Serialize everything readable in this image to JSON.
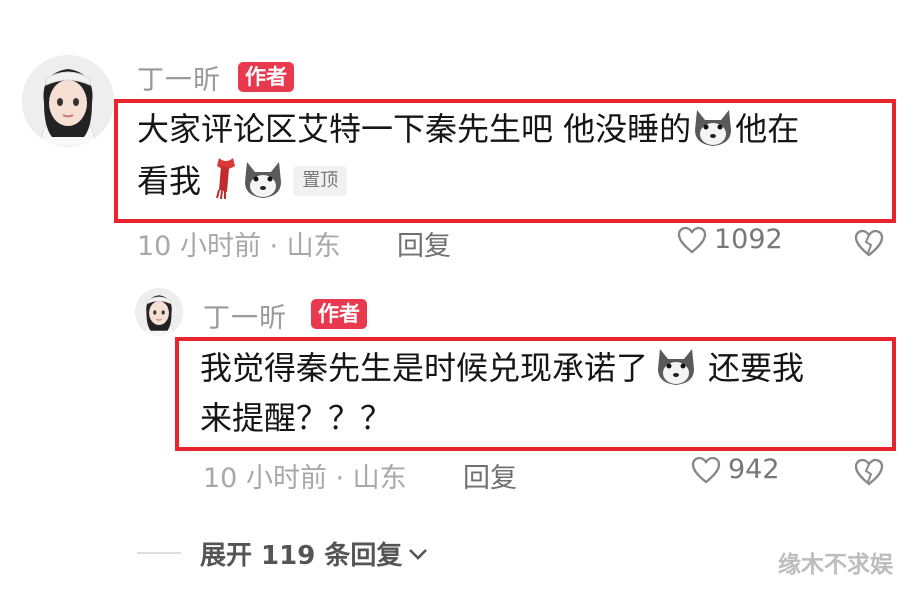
{
  "comment1": {
    "username": "丁一昕",
    "badge": "作者",
    "text_line1": "大家评论区艾特一下秦先生吧 他没睡的",
    "text_line1_end": "他在",
    "text_line2": "看我",
    "pinned": "置顶",
    "meta": "10 小时前 · 山东",
    "reply": "回复",
    "likes": "1092"
  },
  "comment2": {
    "username": "丁一昕",
    "badge": "作者",
    "text_line1": "我觉得秦先生是时候兑现承诺了",
    "text_line1_end": "还要我",
    "text_line2": "来提醒？？？",
    "meta": "10 小时前 · 山东",
    "reply": "回复",
    "likes": "942"
  },
  "expand": {
    "label": "展开 119 条回复"
  },
  "watermark": "缘木不求娱",
  "colors": {
    "badge": "#e8394f",
    "highlight": "#e8242c"
  },
  "icons": [
    "avatar",
    "husky-emoji",
    "scarf-emoji",
    "heart-outline-icon",
    "broken-heart-icon",
    "chevron-down-icon"
  ]
}
